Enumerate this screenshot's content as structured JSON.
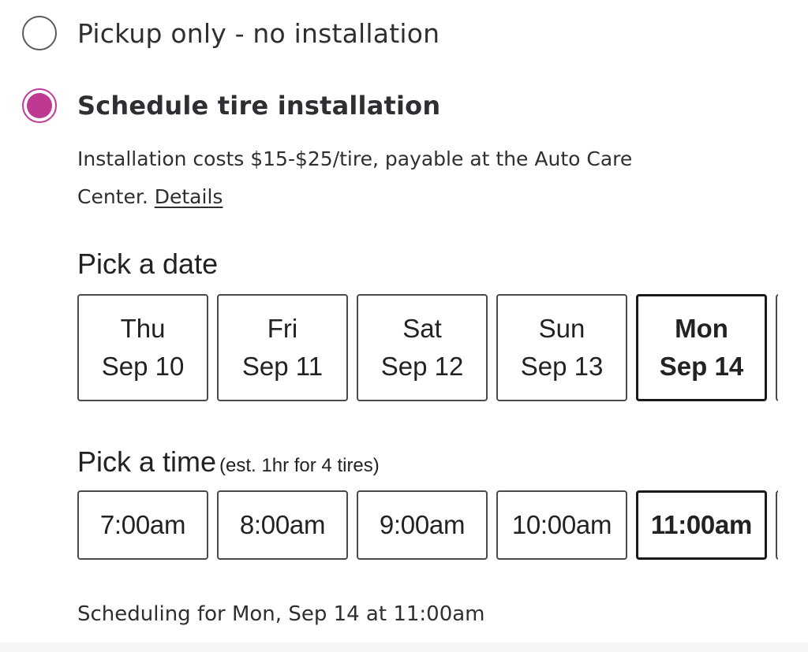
{
  "options": {
    "pickup": {
      "label": "Pickup only - no installation",
      "selected": false
    },
    "schedule": {
      "label": "Schedule tire installation",
      "selected": true
    }
  },
  "install_info": {
    "text": "Installation costs $15-$25/tire, payable at the Auto Care Center. ",
    "details_link": "Details"
  },
  "date_picker": {
    "title": "Pick a date",
    "dates": [
      {
        "day": "Thu",
        "date": "Sep 10",
        "selected": false
      },
      {
        "day": "Fri",
        "date": "Sep 11",
        "selected": false
      },
      {
        "day": "Sat",
        "date": "Sep 12",
        "selected": false
      },
      {
        "day": "Sun",
        "date": "Sep 13",
        "selected": false
      },
      {
        "day": "Mon",
        "date": "Sep 14",
        "selected": true
      },
      {
        "day": "",
        "date": "",
        "selected": false
      }
    ]
  },
  "time_picker": {
    "title": "Pick a time",
    "subtitle": "(est. 1hr for 4 tires)",
    "times": [
      {
        "time": "7:00am",
        "selected": false
      },
      {
        "time": "8:00am",
        "selected": false
      },
      {
        "time": "9:00am",
        "selected": false
      },
      {
        "time": "10:00am",
        "selected": false
      },
      {
        "time": "11:00am",
        "selected": true
      },
      {
        "time": "",
        "selected": false
      }
    ]
  },
  "summary": "Scheduling for Mon, Sep 14 at 11:00am",
  "colors": {
    "accent": "#be3a92",
    "text": "#2e2f32",
    "selected_border": "#1a1a1a"
  }
}
